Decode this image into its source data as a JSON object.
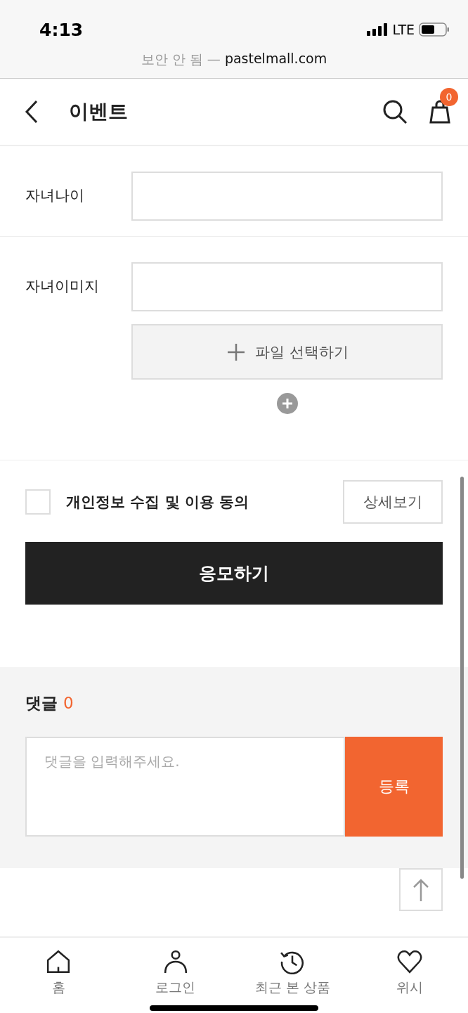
{
  "status_bar": {
    "time": "4:13",
    "network": "LTE"
  },
  "address_bar": {
    "security": "보안 안 됨 —",
    "domain": "pastelmall.com"
  },
  "header": {
    "title": "이벤트",
    "cart_count": "0"
  },
  "form": {
    "rows": [
      {
        "label": "자녀나이",
        "value": ""
      },
      {
        "label": "자녀이미지",
        "value": "",
        "file_button": "파일 선택하기"
      }
    ]
  },
  "agreement": {
    "label": "개인정보 수집 및 이용 동의",
    "checked": false,
    "details_button": "상세보기"
  },
  "submit_button": "응모하기",
  "comments": {
    "title": "댓글",
    "count": "0",
    "placeholder": "댓글을 입력해주세요.",
    "submit": "등록"
  },
  "bottom_nav": [
    {
      "kind": "home",
      "label": "홈"
    },
    {
      "kind": "person",
      "label": "로그인"
    },
    {
      "kind": "history",
      "label": "최근 본 상품"
    },
    {
      "kind": "heart",
      "label": "위시"
    }
  ]
}
